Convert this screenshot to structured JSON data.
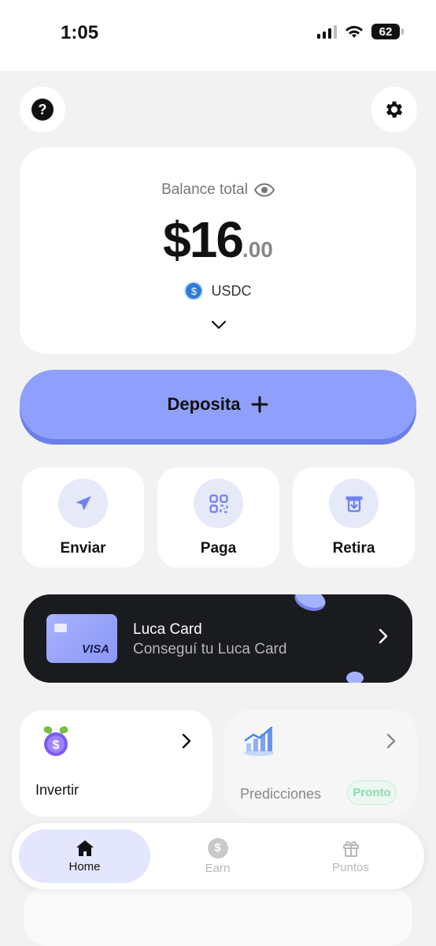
{
  "status_bar": {
    "time": "1:05",
    "battery": "62"
  },
  "header": {
    "help_icon": "help-icon",
    "settings_icon": "gear-icon"
  },
  "balance": {
    "label": "Balance total",
    "amount_main": "$16",
    "amount_decimals": ".00",
    "currency": "USDC"
  },
  "deposit": {
    "label": "Deposita"
  },
  "actions": [
    {
      "label": "Enviar",
      "icon": "send-icon"
    },
    {
      "label": "Paga",
      "icon": "qr-code-icon"
    },
    {
      "label": "Retira",
      "icon": "withdraw-icon"
    }
  ],
  "luca_card": {
    "title": "Luca Card",
    "subtitle": "Conseguí tu Luca Card",
    "card_brand": "VISA"
  },
  "tiles": [
    {
      "label": "Invertir",
      "icon": "invest-coin-icon"
    },
    {
      "label": "Predicciones",
      "icon": "chart-icon",
      "badge": "Pronto"
    }
  ],
  "bottom_nav": [
    {
      "label": "Home",
      "icon": "home-icon",
      "active": true
    },
    {
      "label": "Earn",
      "icon": "dollar-coin-icon",
      "active": false
    },
    {
      "label": "Puntos",
      "icon": "gift-icon",
      "active": false
    }
  ],
  "colors": {
    "accent": "#8ea0fb",
    "accent_dark": "#6a7fe8",
    "nav_active_bg": "#e3e6fd",
    "banner_bg": "#1a1b1f",
    "badge_green": "#8fd8b0"
  }
}
